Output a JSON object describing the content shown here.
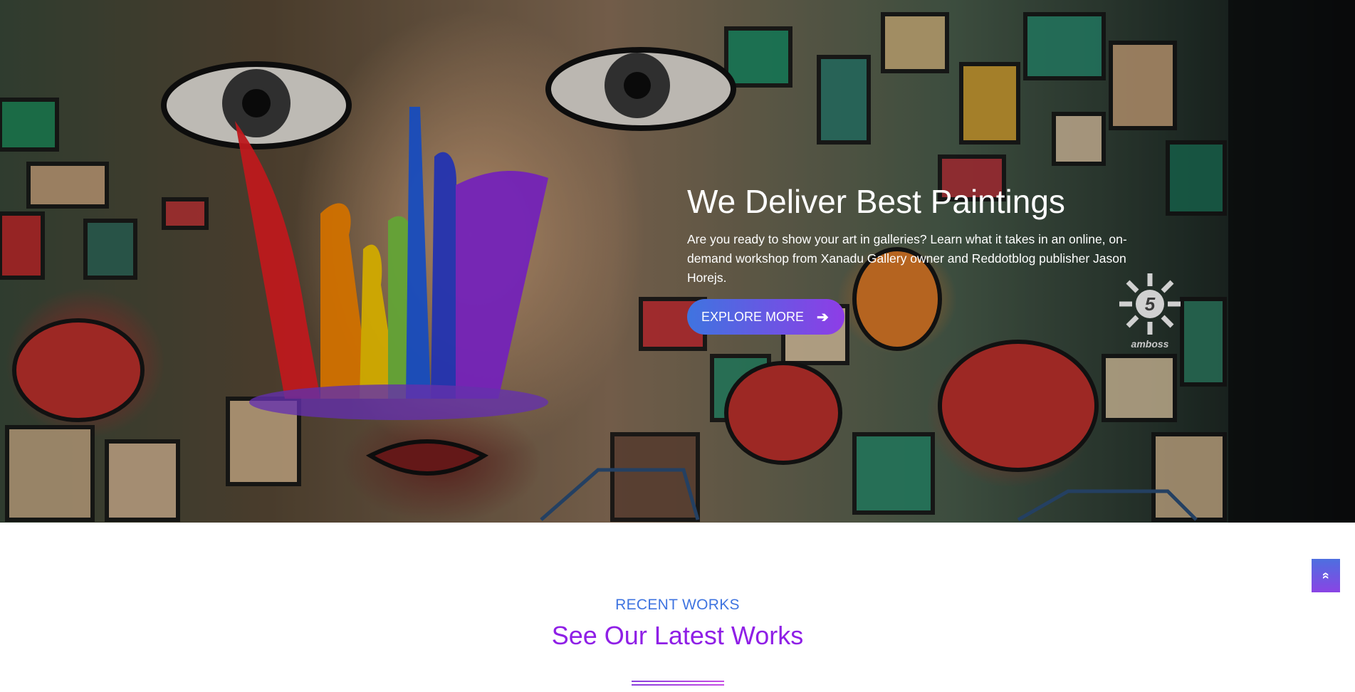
{
  "hero": {
    "title": "We Deliver Best Paintings",
    "text": "Are you ready to show your art in galleries? Learn what it takes in an online, on-demand workshop from Xanadu Gallery owner and Reddotblog publisher Jason Horejs.",
    "cta_label": "EXPLORE MORE",
    "cta_icon": "arrow-right-icon",
    "logo_text": "amboss",
    "logo_number": "5"
  },
  "recent": {
    "eyebrow": "RECENT WORKS",
    "title": "See Our Latest Works"
  },
  "scroll_top": {
    "icon": "double-chevron-up-icon",
    "glyph": "«"
  },
  "colors": {
    "accent_blue": "#3f74e0",
    "accent_purple": "#8f1fe6"
  }
}
